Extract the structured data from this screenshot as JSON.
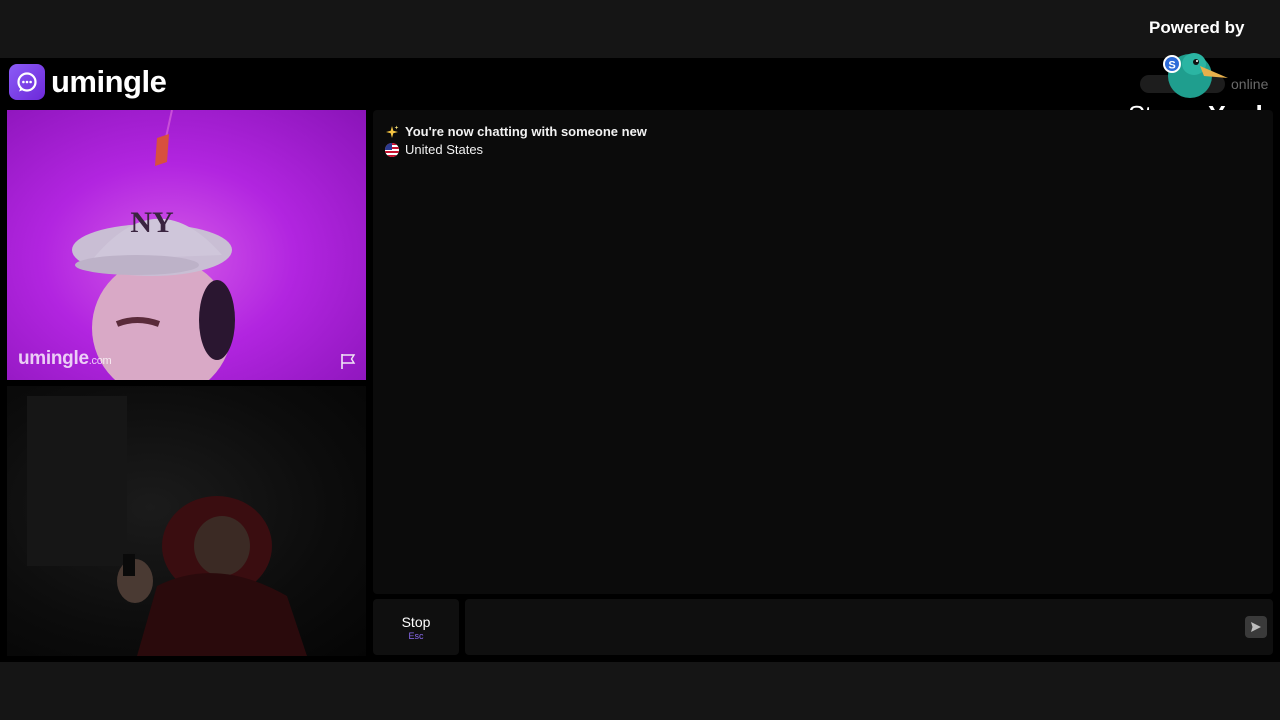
{
  "header": {
    "app_name": "umingle",
    "online_label": "online"
  },
  "overlay": {
    "powered_by": "Powered by",
    "brand_part1": "Stream",
    "brand_part2": "Yard"
  },
  "videos": {
    "stranger": {
      "watermark": "umingle",
      "watermark_suffix": ".com"
    }
  },
  "chat": {
    "messages": [
      {
        "icon": "sparkles-icon",
        "text": "You're now chatting with someone new"
      },
      {
        "icon": "us-flag-icon",
        "text": "United States"
      }
    ]
  },
  "controls": {
    "stop_label": "Stop",
    "stop_hint": "Esc",
    "message_placeholder": ""
  },
  "colors": {
    "accent": "#7c4dff",
    "background": "#000000",
    "panel": "#0b0b0b"
  }
}
